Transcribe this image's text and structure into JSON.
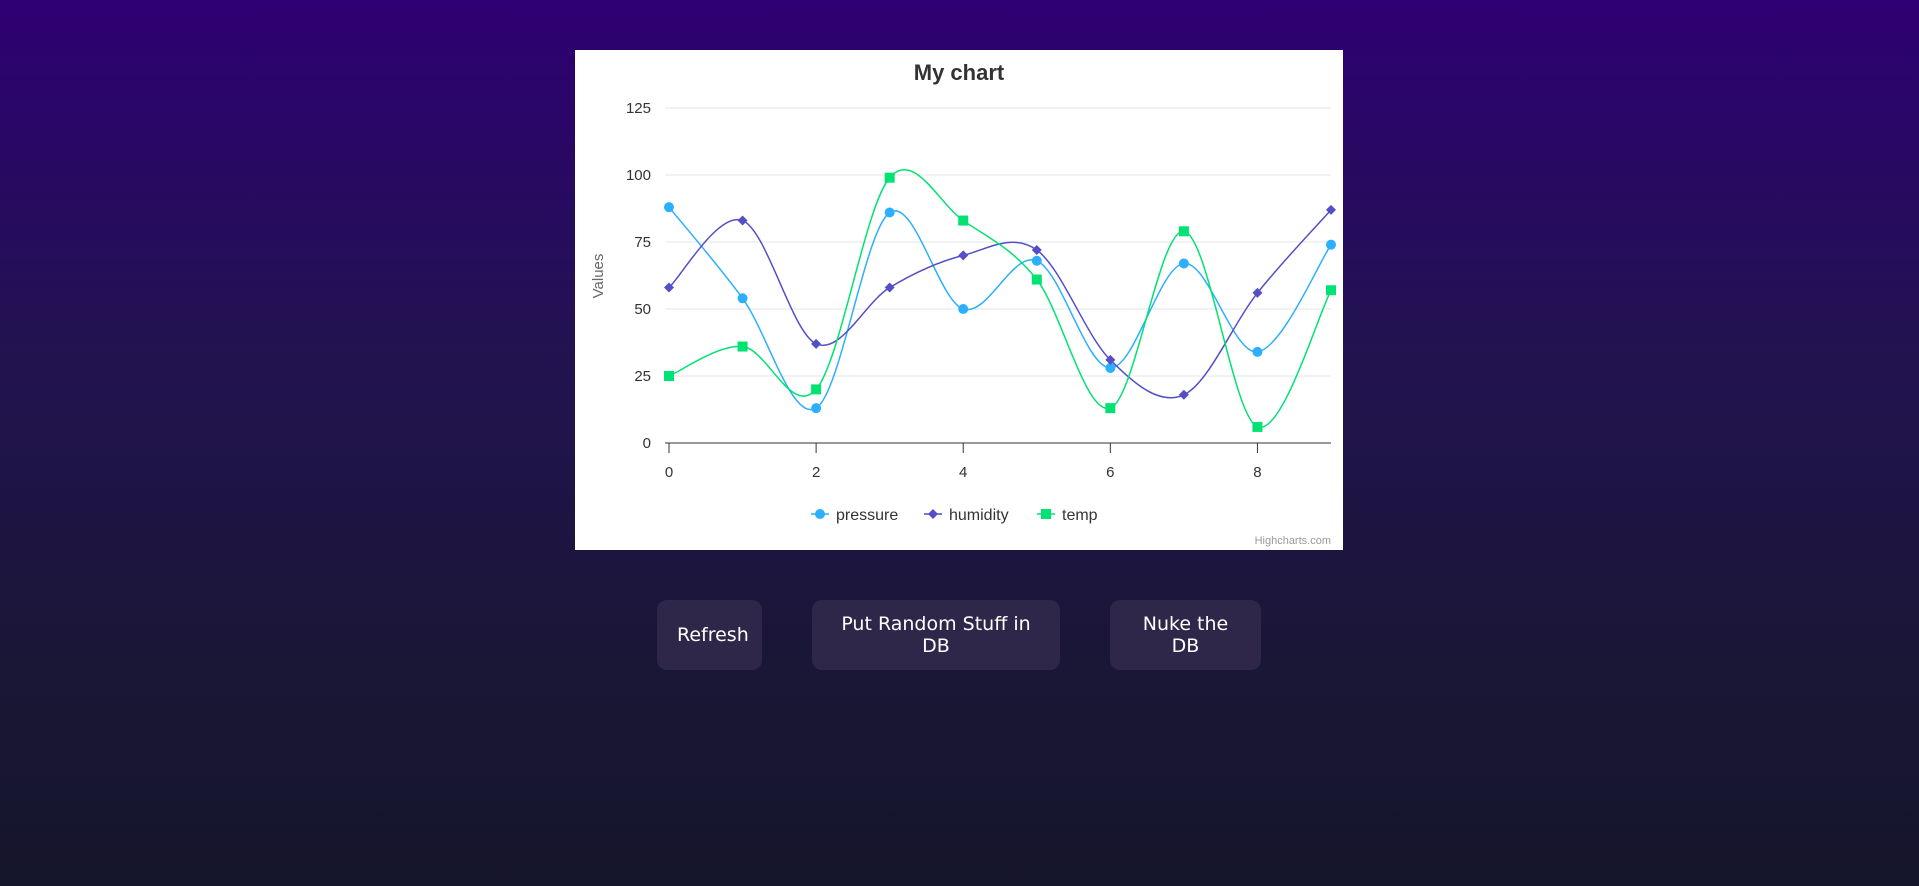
{
  "buttons": {
    "refresh": "Refresh",
    "random": "Put Random Stuff in DB",
    "nuke": "Nuke the DB"
  },
  "chart_data": {
    "type": "line",
    "title": "My chart",
    "xlabel": "",
    "ylabel": "Values",
    "xlim": [
      0,
      9
    ],
    "ylim": [
      0,
      125
    ],
    "x_ticks": [
      0,
      2,
      4,
      6,
      8
    ],
    "y_ticks": [
      0,
      25,
      50,
      75,
      100,
      125
    ],
    "grid": true,
    "legend": "bottom-center",
    "credits": "Highcharts.com",
    "x": [
      0,
      1,
      2,
      3,
      4,
      5,
      6,
      7,
      8,
      9
    ],
    "series": [
      {
        "name": "pressure",
        "marker": "circle",
        "color": "#2caffe",
        "values": [
          88,
          54,
          13,
          86,
          50,
          68,
          28,
          67,
          34,
          74
        ]
      },
      {
        "name": "humidity",
        "marker": "diamond",
        "color": "#544fc5",
        "values": [
          58,
          83,
          37,
          58,
          70,
          72,
          31,
          18,
          56,
          87
        ]
      },
      {
        "name": "temp",
        "marker": "square",
        "color": "#00e272",
        "values": [
          25,
          36,
          20,
          99,
          83,
          61,
          13,
          79,
          6,
          57
        ]
      }
    ]
  }
}
